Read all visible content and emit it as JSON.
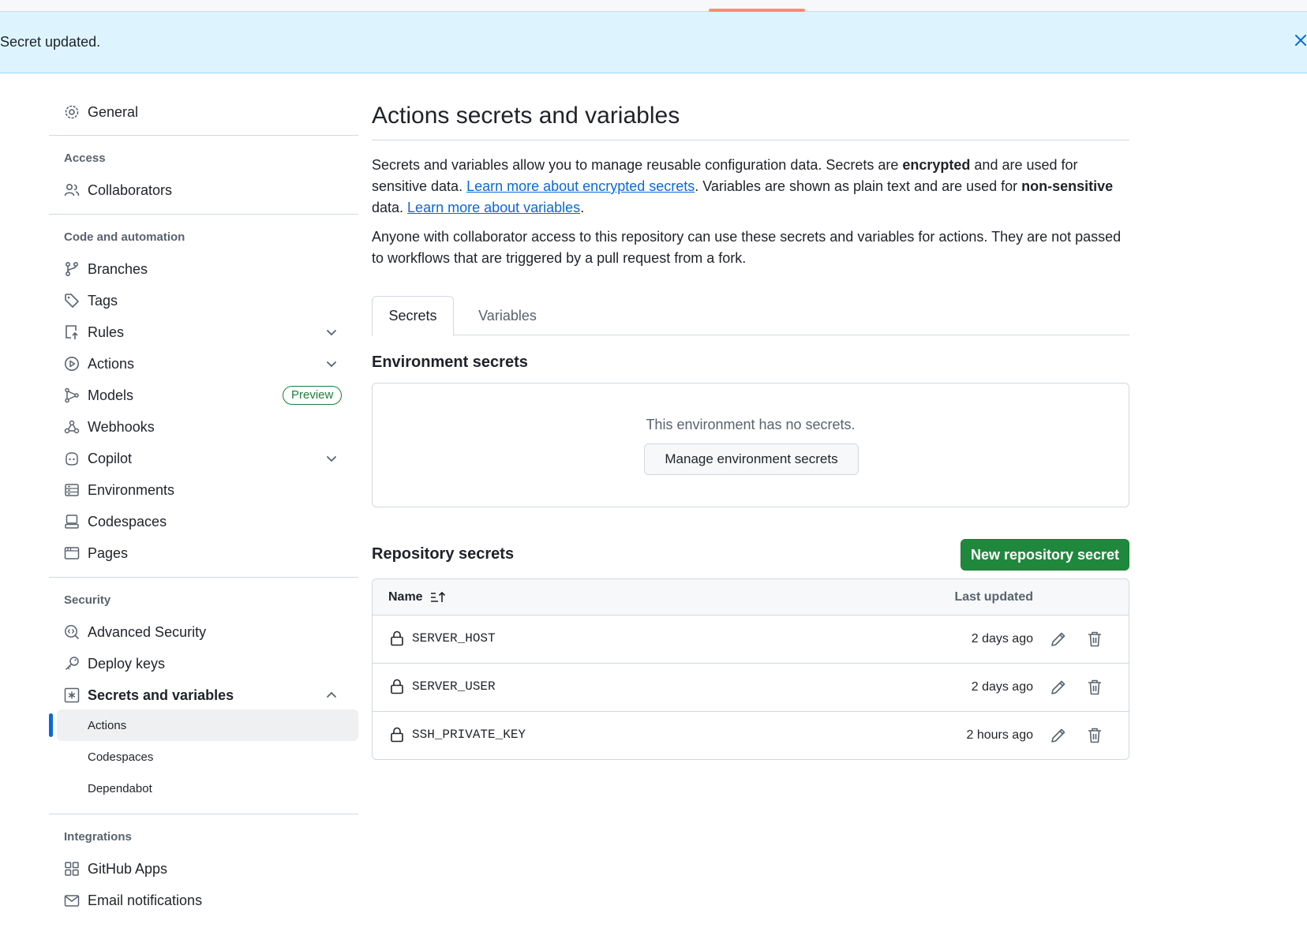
{
  "flash": {
    "message": "Secret updated."
  },
  "sidebar": {
    "general": "General",
    "sections": {
      "access": "Access",
      "code_automation": "Code and automation",
      "security": "Security",
      "integrations": "Integrations"
    },
    "items": {
      "collaborators": "Collaborators",
      "branches": "Branches",
      "tags": "Tags",
      "rules": "Rules",
      "actions": "Actions",
      "models": "Models",
      "models_badge": "Preview",
      "webhooks": "Webhooks",
      "copilot": "Copilot",
      "environments": "Environments",
      "codespaces": "Codespaces",
      "pages": "Pages",
      "advanced_security": "Advanced Security",
      "deploy_keys": "Deploy keys",
      "secrets_variables": "Secrets and variables",
      "github_apps": "GitHub Apps",
      "email_notifications": "Email notifications"
    },
    "sub_items": {
      "actions": "Actions",
      "codespaces": "Codespaces",
      "dependabot": "Dependabot"
    }
  },
  "main": {
    "title": "Actions secrets and variables",
    "desc1": {
      "part1": "Secrets and variables allow you to manage reusable configuration data. Secrets are ",
      "bold1": "encrypted",
      "part2": " and are used for sensitive data. ",
      "link1": "Learn more about encrypted secrets",
      "part3": ". Variables are shown as plain text and are used for ",
      "bold2": "non-sensitive",
      "part4": " data. ",
      "link2": "Learn more about variables",
      "part5": "."
    },
    "desc2": "Anyone with collaborator access to this repository can use these secrets and variables for actions. They are not passed to workflows that are triggered by a pull request from a fork.",
    "tabs": {
      "secrets": "Secrets",
      "variables": "Variables"
    },
    "env_heading": "Environment secrets",
    "env_empty": "This environment has no secrets.",
    "env_button": "Manage environment secrets",
    "repo_heading": "Repository secrets",
    "new_button": "New repository secret",
    "table": {
      "col_name": "Name",
      "col_updated": "Last updated",
      "rows": [
        {
          "name": "SERVER_HOST",
          "updated": "2 days ago"
        },
        {
          "name": "SERVER_USER",
          "updated": "2 days ago"
        },
        {
          "name": "SSH_PRIVATE_KEY",
          "updated": "2 hours ago"
        }
      ]
    }
  },
  "colors": {
    "accent_blue": "#0969da",
    "primary_green": "#1f883d",
    "flash_bg": "#ddf4ff",
    "tab_accent": "#fd8c73"
  },
  "icons": [
    "gear-icon",
    "people-icon",
    "git-branch-icon",
    "tag-icon",
    "rules-icon",
    "play-icon",
    "models-icon",
    "webhook-icon",
    "copilot-icon",
    "server-icon",
    "codespaces-icon",
    "browser-icon",
    "codescan-icon",
    "key-icon",
    "asterisk-icon",
    "apps-icon",
    "mail-icon",
    "chevron-down-icon",
    "chevron-up-icon",
    "lock-icon",
    "pencil-icon",
    "trash-icon",
    "sort-icon",
    "close-icon"
  ]
}
